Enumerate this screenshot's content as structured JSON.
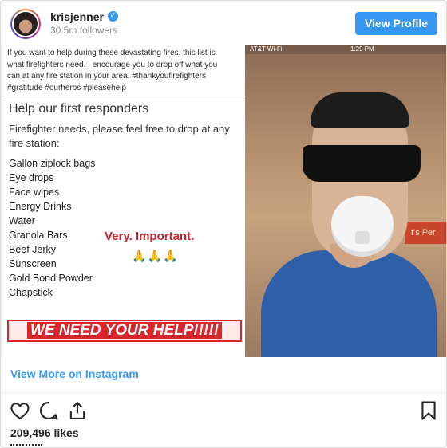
{
  "header": {
    "username": "krisjenner",
    "verified_icon": "verified-check-icon",
    "followers": "30.5m followers",
    "view_profile_label": "View Profile",
    "accent_color": "#3897f0"
  },
  "post": {
    "caption": "If you want to help during these devastating fires, this list is\nwhat firefighters need. I encourage you to drop off what you\ncan at any fire station in your area. #thankyoufirefighters\n#gratitude #ourheros #pleasehelp",
    "title": "Help our first responders",
    "subtitle": "Firefighter needs, please feel free to drop at any\nfire station:",
    "needs": [
      "Gallon ziplock bags",
      "Eye drops",
      "Face wipes",
      "Energy Drinks",
      "Water",
      "Granola Bars",
      "Beef Jerky",
      "Sunscreen",
      "Gold Bond Powder",
      "Chapstick"
    ],
    "important": "Very. Important.",
    "hands": "🙏🙏🙏",
    "banner": "WE NEED YOUR HELP!!!!!"
  },
  "photo": {
    "carrier": "AT&T Wi-Fi",
    "clock": "1:29 PM",
    "wall_sign": "t's Per"
  },
  "footer": {
    "view_more": "View More on Instagram",
    "likes": "209,496 likes"
  }
}
